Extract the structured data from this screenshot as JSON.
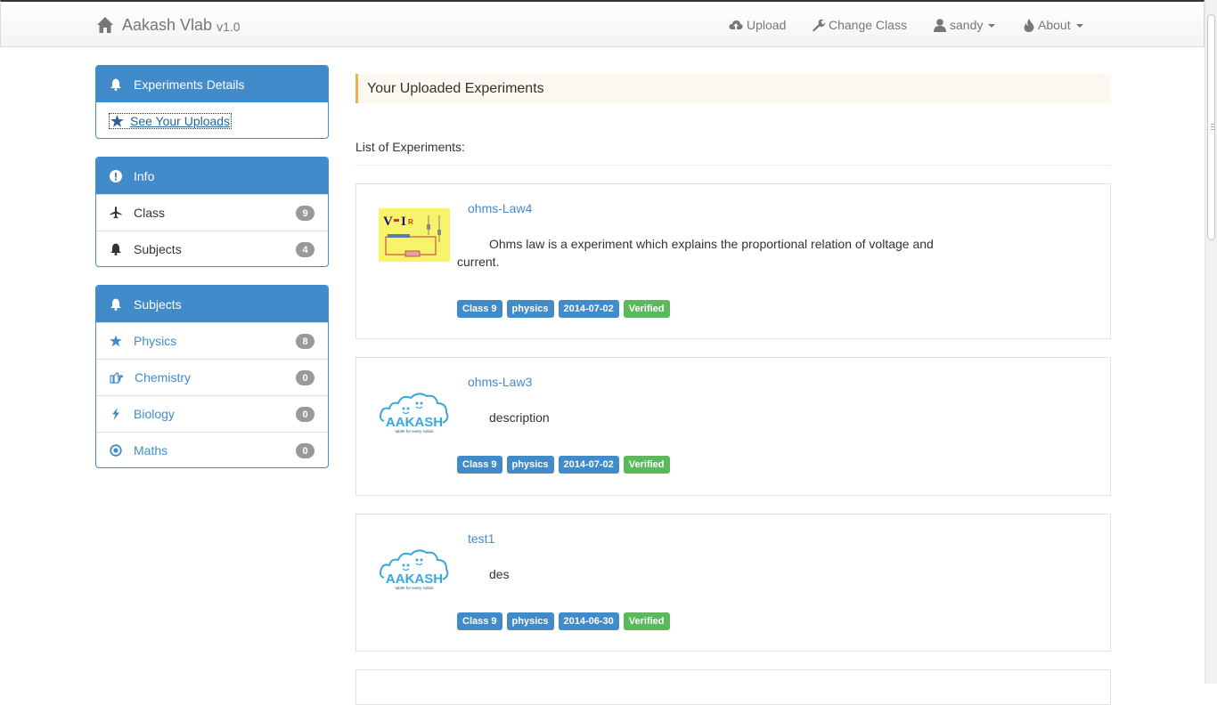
{
  "brand": {
    "name": "Aakash Vlab",
    "version": "v1.0"
  },
  "nav": {
    "upload": "Upload",
    "change_class": "Change Class",
    "user": "sandy",
    "about": "About"
  },
  "sidebar": {
    "experiments": {
      "title": "Experiments Details",
      "link": "See Your Uploads"
    },
    "info": {
      "title": "Info",
      "items": [
        {
          "label": "Class",
          "count": "9"
        },
        {
          "label": "Subjects",
          "count": "4"
        }
      ]
    },
    "subjects": {
      "title": "Subjects",
      "items": [
        {
          "label": "Physics",
          "count": "8"
        },
        {
          "label": "Chemistry",
          "count": "0"
        },
        {
          "label": "Biology",
          "count": "0"
        },
        {
          "label": "Maths",
          "count": "0"
        }
      ]
    }
  },
  "main": {
    "header": "Your Uploaded Experiments",
    "list_title": "List of Experiments:",
    "experiments": [
      {
        "title": "ohms-Law4",
        "description": "Ohms law is a experiment which explains the proportional relation of voltage and current.",
        "class": "Class 9",
        "subject": "physics",
        "date": "2014-07-02",
        "status": "Verified",
        "thumb_text": "V=IR"
      },
      {
        "title": "ohms-Law3",
        "description": "description",
        "class": "Class 9",
        "subject": "physics",
        "date": "2014-07-02",
        "status": "Verified",
        "thumb_text": "AAKASH",
        "thumb_sub": "tablet for every indian"
      },
      {
        "title": "test1",
        "description": "des",
        "class": "Class 9",
        "subject": "physics",
        "date": "2014-06-30",
        "status": "Verified",
        "thumb_text": "AAKASH",
        "thumb_sub": "tablet for every indian"
      }
    ]
  },
  "colors": {
    "primary": "#428bca",
    "success": "#5cb85c",
    "warning": "#f0ad4e",
    "badge": "#999999"
  }
}
